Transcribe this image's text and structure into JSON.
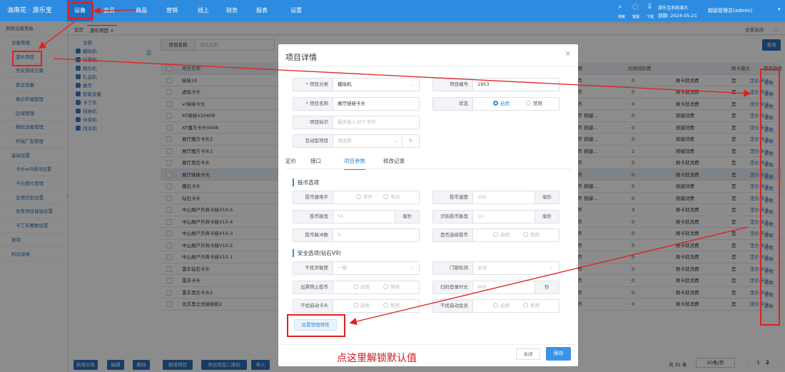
{
  "topbar": {
    "brand": "油南花 · 游乐宝",
    "nav": [
      "设备",
      "会员",
      "商品",
      "营销",
      "线上",
      "财务",
      "报表",
      "设置"
    ],
    "active_nav": "设备",
    "tools": [
      "搜索",
      "客服",
      "下载"
    ],
    "system": "游乐宝系统演示",
    "expiry": "到期: 2024-05-21",
    "user": "超级管理员(admin)"
  },
  "sidebar": {
    "top": "致娱设备看板",
    "items": [
      {
        "label": "设备管理",
        "type": "grp"
      },
      {
        "label": "游乐项目",
        "type": "sub"
      },
      {
        "label": "开房游戏方案",
        "type": "sub"
      },
      {
        "label": "营业设备",
        "type": "sub"
      },
      {
        "label": "展示终端管理",
        "type": "sub"
      },
      {
        "label": "区域管理",
        "type": "sub"
      },
      {
        "label": "畅玩设备管理",
        "type": "sub"
      },
      {
        "label": "终端广告管理",
        "type": "sub"
      },
      {
        "label": "基础设置",
        "type": "grp"
      },
      {
        "label": "卡头wifi通讯设置",
        "type": "sub"
      },
      {
        "label": "卡头图片管理",
        "type": "sub"
      },
      {
        "label": "生物识别设置",
        "type": "sub"
      },
      {
        "label": "体育项目基础设置",
        "type": "sub"
      },
      {
        "label": "卡丁车赛数设置",
        "type": "sub"
      },
      {
        "label": "查询",
        "type": "grp"
      },
      {
        "label": "机台运维",
        "type": "grp"
      }
    ]
  },
  "tabs": {
    "home": "首页",
    "current": "游乐项目",
    "close_all": "全部关闭"
  },
  "categories": [
    "全部",
    "模拟机",
    "彩票机",
    "娱乐机",
    "礼品机",
    "推币",
    "智能设备",
    "卡丁车",
    "娃娃机",
    "中奖机",
    "闯关机"
  ],
  "search": {
    "label": "项目名称",
    "placeholder": "项目名称",
    "button": "查询"
  },
  "table": {
    "headers": [
      "项目名称",
      "扣费",
      "扣款回扣费",
      "刷卡模式",
      "是否启用",
      "操作"
    ],
    "rows": [
      [
        "娃娃10",
        "代币",
        "0",
        "刷卡就消费",
        "是"
      ],
      [
        "虚拟卡头",
        "代币",
        "0",
        "刷卡就消费",
        "是"
      ],
      [
        "vr娃娃卡头",
        "代币",
        "0",
        "刷卡就消费",
        "是"
      ],
      [
        "XF娃娃V10408",
        "代币 按键...",
        "0",
        "按键消费",
        "是"
      ],
      [
        "XF魔方卡头0408",
        "代币 按键...",
        "0",
        "按键消费",
        "是"
      ],
      [
        "展厅魔方卡头2",
        "代币 按键...",
        "0",
        "按键消费",
        "是"
      ],
      [
        "展厅魔方卡头1",
        "代币 按键...",
        "1",
        "按键消费",
        "是"
      ],
      [
        "展厅黑石卡头",
        "代币",
        "0",
        "刷卡就消费",
        "是"
      ],
      [
        "展厅娃娃卡头",
        "代币",
        "0",
        "刷卡就消费",
        "是"
      ],
      [
        "魔石卡头",
        "代币 按键...",
        "0",
        "按键消费",
        "是"
      ],
      [
        "钻石卡头",
        "代币 按键...",
        "0",
        "按键消费",
        "是"
      ],
      [
        "中山展户外商卡娃V10-5",
        "代币",
        "3",
        "刷卡就消费",
        "是"
      ],
      [
        "中山展户外商卡娃V10-4",
        "代币",
        "0",
        "刷卡就消费",
        "是"
      ],
      [
        "中山展户外商卡娃V10-3",
        "代币",
        "0",
        "刷卡就消费",
        "是"
      ],
      [
        "中山展户外商卡娃V10-2",
        "代币",
        "0",
        "刷卡就消费",
        "是"
      ],
      [
        "中山展户外商卡娃V10-1",
        "代币",
        "0",
        "刷卡就消费",
        "是"
      ],
      [
        "雷丰钻石卡头",
        "代币",
        "0",
        "刷卡就消费",
        "是"
      ],
      [
        "雷丰卡头",
        "代币",
        "0",
        "刷卡就消费",
        "是"
      ],
      [
        "雷丰黑石卡头2",
        "代币",
        "0",
        "刷卡就消费",
        "是"
      ],
      [
        "北京黑立式娃娃机2",
        "代币",
        "0",
        "刷卡就消费",
        "是"
      ]
    ],
    "actions": [
      "定价",
      "卡头",
      "参数"
    ],
    "highlight_row": 8
  },
  "footer": {
    "buttons": [
      "新增分类",
      "编辑",
      "删除",
      "新增项目",
      "导出项目二维码",
      "导入"
    ],
    "total": "共 31 条",
    "page_size": "20条/页",
    "pages": [
      "1",
      "2"
    ],
    "current_page": "1"
  },
  "modal": {
    "title": "项目详情",
    "category": {
      "label": "项目分类",
      "value": "模拟机"
    },
    "code": {
      "label": "项目编号",
      "value": "1953"
    },
    "name": {
      "label": "项目名称",
      "value": "展厅娃娃卡头"
    },
    "status": {
      "label": "状态",
      "options": [
        "启用",
        "禁用"
      ],
      "selected": "启用"
    },
    "tag": {
      "label": "项目标识",
      "placeholder": "最多输入30个字符"
    },
    "linked": {
      "label": "互动型项目",
      "placeholder": "请选择"
    },
    "tabs": [
      "定价",
      "接口",
      "项目参数",
      "修改记录"
    ],
    "active_tab": "项目参数",
    "sec1": "投币选项",
    "sec2": "安全选项(钻石V9)",
    "f1": {
      "label": "投币器电平",
      "options": [
        "常开",
        "常闭"
      ],
      "selected": "常开"
    },
    "f2": {
      "label": "投币速度",
      "value": "200",
      "unit": "毫秒"
    },
    "f3": {
      "label": "投币脉宽",
      "value": "50",
      "unit": "毫秒"
    },
    "f4": {
      "label": "识别投币脉宽",
      "value": "10",
      "unit": "毫秒"
    },
    "f5": {
      "label": "投币脉冲数",
      "value": "0"
    },
    "f6": {
      "label": "是否连续投币",
      "options": [
        "启用",
        "禁用"
      ],
      "selected": "启用"
    },
    "f7": {
      "label": "干扰灵敏度",
      "value": "一般"
    },
    "f8": {
      "label": "门锁检测",
      "value": "关闭"
    },
    "f9": {
      "label": "出票禁止投币",
      "options": [
        "启用",
        "禁用"
      ],
      "selected": "禁用"
    },
    "f10": {
      "label": "扫码登录时长",
      "value": "600",
      "unit": "秒"
    },
    "f11": {
      "label": "干扰启动卡头",
      "options": [
        "启用",
        "禁用"
      ],
      "selected": "启用"
    },
    "f12": {
      "label": "干扰启动会员",
      "options": [
        "启用",
        "禁用"
      ],
      "selected": "禁用"
    },
    "physics_button": "设置物理特性",
    "close": "关闭",
    "save": "保存"
  },
  "annotation": {
    "hint": "点这里解锁默认值",
    "color": "#e02020"
  }
}
